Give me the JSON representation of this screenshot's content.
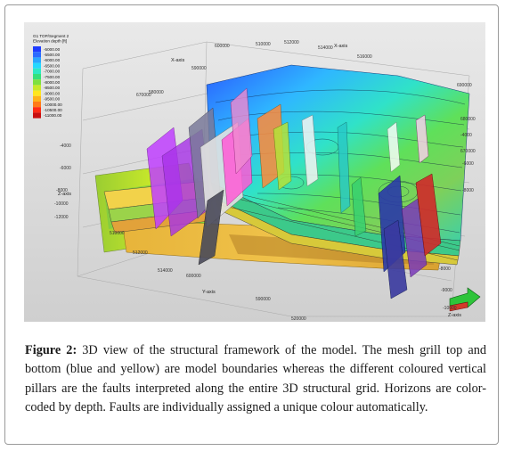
{
  "figure": {
    "legend": {
      "title": "G1 TOP/Segment 2",
      "subtitle": "Elevation depth [ft]",
      "entries": [
        {
          "label": "-5000.00",
          "color": "#1f3cff"
        },
        {
          "label": "-5500.00",
          "color": "#2b6bff"
        },
        {
          "label": "-6000.00",
          "color": "#2aa6ff"
        },
        {
          "label": "-6500.00",
          "color": "#25d8ff"
        },
        {
          "label": "-7000.00",
          "color": "#2ee8c4"
        },
        {
          "label": "-7500.00",
          "color": "#36e07a"
        },
        {
          "label": "-8000.00",
          "color": "#7ee040"
        },
        {
          "label": "-8500.00",
          "color": "#c8e82a"
        },
        {
          "label": "-9000.00",
          "color": "#ffe61e"
        },
        {
          "label": "-9500.00",
          "color": "#ffb21a"
        },
        {
          "label": "-10000.00",
          "color": "#ff7a18"
        },
        {
          "label": "-10500.00",
          "color": "#ff2a14"
        },
        {
          "label": "-11000.00",
          "color": "#c80f0f"
        }
      ]
    },
    "axes": {
      "x_axis_label": "X-axis",
      "y_axis_label": "Y-axis",
      "z_axis_label": "Z-axis",
      "x_ticks_top": [
        "510000",
        "512000",
        "514000",
        "516000"
      ],
      "y_ticks_top": [
        "600000",
        "590000",
        "580000"
      ],
      "y_ticks_right": [
        "690000",
        "680000",
        "670000"
      ],
      "y_ticks_left": [
        "670000"
      ],
      "z_ticks_left": [
        "-4000",
        "-6000",
        "-8000",
        "-10000",
        "-12000"
      ],
      "z_ticks_right": [
        "-4000",
        "-6000",
        "-8000"
      ],
      "x_ticks_bottom": [
        "510000",
        "512000",
        "514000"
      ],
      "y_ticks_bottom": [
        "600000",
        "590000"
      ],
      "z_ticks_bottom_right": [
        "-8000",
        "-9000",
        "-10000"
      ],
      "corner_tick": "520000"
    }
  },
  "caption": {
    "label": "Figure 2:",
    "text": " 3D view of the structural framework of the model. The mesh grill top and bottom (blue and yellow) are model boundaries whereas the different coloured vertical pillars are the faults interpreted along the entire 3D structural grid. Horizons are color-coded by depth. Faults are individually assigned a unique colour automatically."
  }
}
